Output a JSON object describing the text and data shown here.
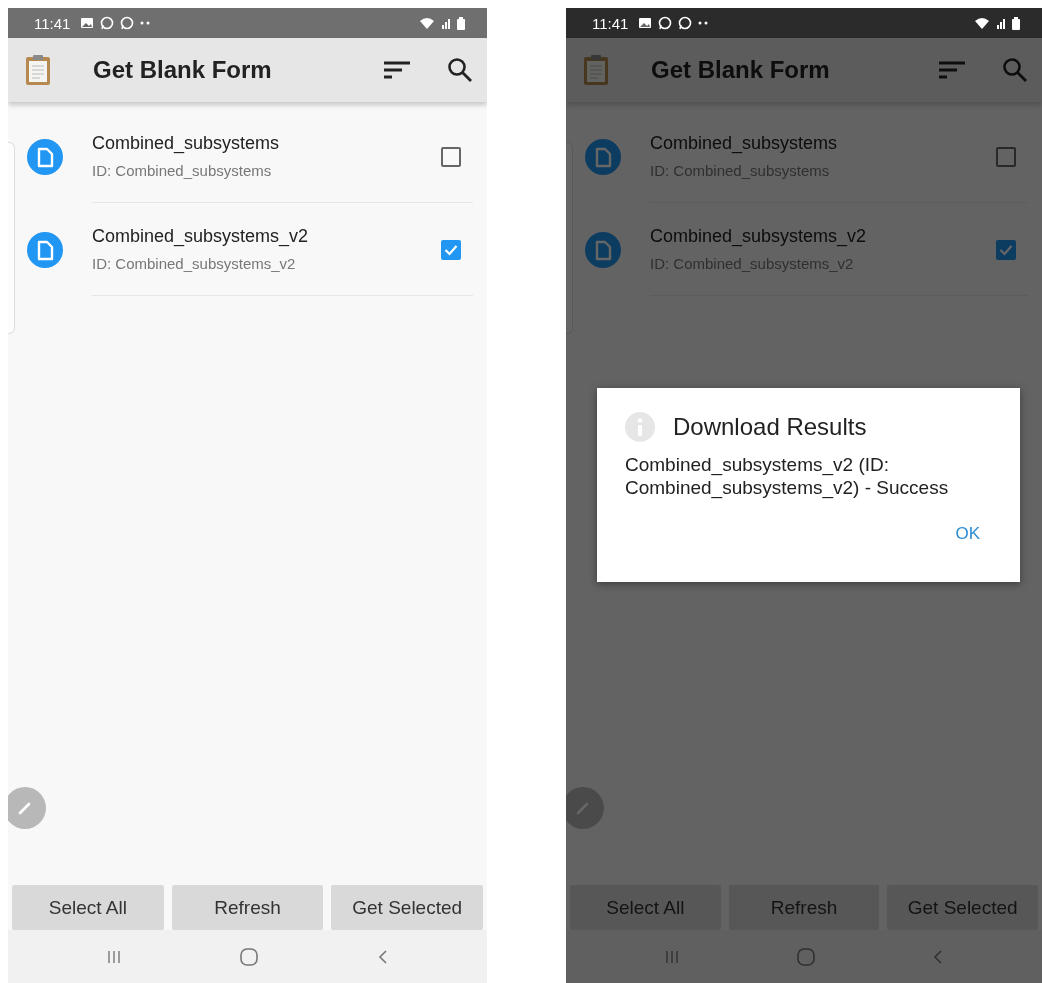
{
  "screens": [
    {
      "status_bar": {
        "time": "11:41"
      },
      "app_bar": {
        "title": "Get Blank Form"
      },
      "forms": [
        {
          "name": "Combined_subsystems",
          "id": "ID: Combined_subsystems",
          "checked": false
        },
        {
          "name": "Combined_subsystems_v2",
          "id": "ID: Combined_subsystems_v2",
          "checked": true
        }
      ],
      "buttons": [
        "Select All",
        "Refresh",
        "Get Selected"
      ]
    },
    {
      "status_bar": {
        "time": "11:41"
      },
      "app_bar": {
        "title": "Get Blank Form"
      },
      "forms": [
        {
          "name": "Combined_subsystems",
          "id": "ID: Combined_subsystems",
          "checked": false
        },
        {
          "name": "Combined_subsystems_v2",
          "id": "ID: Combined_subsystems_v2",
          "checked": true
        }
      ],
      "buttons": [
        "Select All",
        "Refresh",
        "Get Selected"
      ],
      "dialog": {
        "title": "Download Results",
        "message": "Combined_subsystems_v2 (ID: Combined_subsystems_v2) - Success",
        "button": "OK"
      }
    }
  ]
}
